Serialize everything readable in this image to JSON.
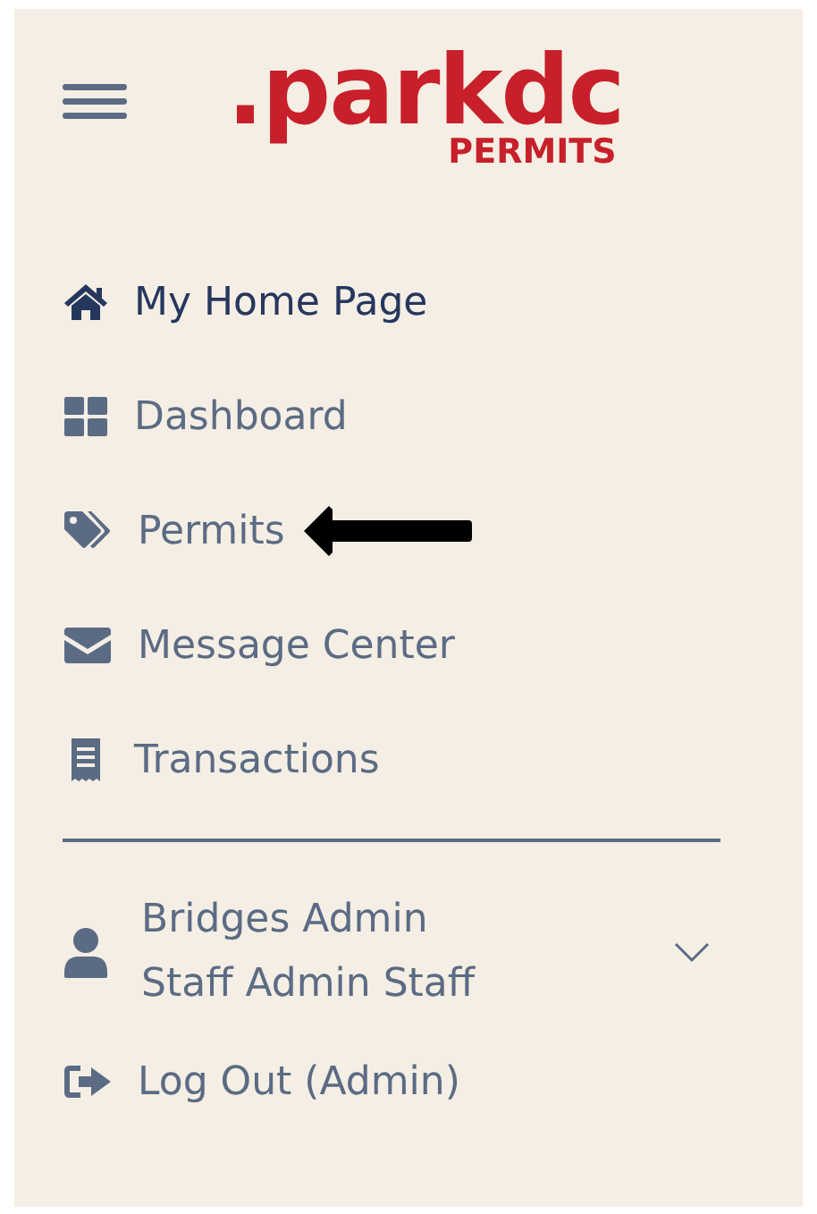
{
  "header": {
    "logo": {
      "wordmark": ".parkdc",
      "subtitle": "PERMITS"
    }
  },
  "nav": {
    "items": [
      {
        "label": "My Home Page",
        "kind": "home",
        "selected": true,
        "pointer": false
      },
      {
        "label": "Dashboard",
        "kind": "grid",
        "selected": false,
        "pointer": false
      },
      {
        "label": "Permits",
        "kind": "tags",
        "selected": false,
        "pointer": true
      },
      {
        "label": "Message Center",
        "kind": "envelope",
        "selected": false,
        "pointer": false
      },
      {
        "label": "Transactions",
        "kind": "receipt",
        "selected": false,
        "pointer": false
      }
    ]
  },
  "user": {
    "name": "Bridges Admin",
    "role": "Staff Admin Staff",
    "expanded": false
  },
  "logout": {
    "label": "Log Out (Admin)"
  }
}
